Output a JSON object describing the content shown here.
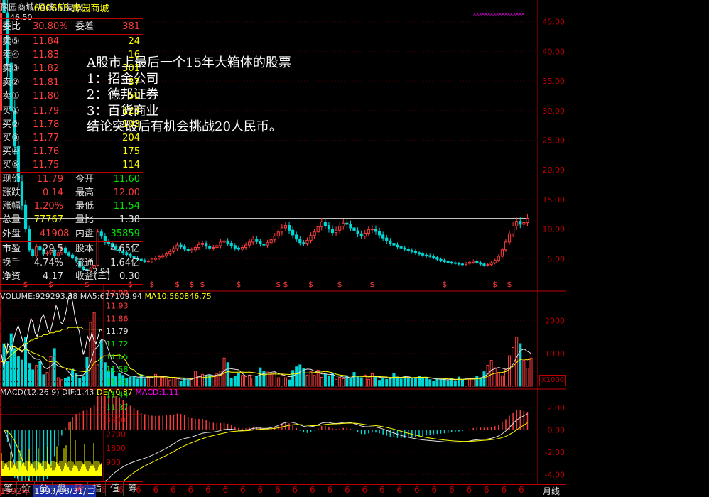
{
  "header": {
    "title": "豫园商城(月线,前复权)",
    "volume_legend": {
      "vol": "VOLUME:929293.38",
      "ma5": "MA5:617109.94",
      "ma10": "MA10:560846.75"
    },
    "macd_legend": {
      "params": "MACD(12,26,9)",
      "dif": "DIF:1.43",
      "dea": "DEA:0.87",
      "macd": "MACD:1.11"
    },
    "unit_label": "X1000"
  },
  "annotation": {
    "lines": [
      "A股市上最后一个15年大箱体的股票",
      "1：招金公司",
      "2：德邦证券",
      "3：百货商业",
      "结论突破后有机会挑战20人民币。"
    ]
  },
  "chart_data": [
    {
      "type": "candlestick",
      "title": "豫园商城(月线,前复权)",
      "y_axis_ticks": [
        "45.00",
        "40.00",
        "35.00",
        "30.00",
        "25.00",
        "20.00",
        "15.00",
        "10.00",
        "5.00"
      ],
      "ylim": [
        0,
        47
      ],
      "price_labels": {
        "high": "46.50",
        "low": "2.94"
      },
      "resistance_line": 11.8,
      "dollar_markers": 17,
      "closes": [
        46.5,
        38,
        30,
        24,
        18,
        14,
        10,
        6.5,
        5.5,
        7,
        6.5,
        5.8,
        6,
        6.4,
        5.5,
        6,
        6.8,
        6,
        5.6,
        5.2,
        4.6,
        3.6,
        3.2,
        3.0,
        3.4,
        3.9,
        9.5,
        8.8,
        7.8,
        7.6,
        7.0,
        6.6,
        6.3,
        6.0,
        5.7,
        5.4,
        5.1,
        4.9,
        4.7,
        4.5,
        4.6,
        4.9,
        5.1,
        5.3,
        5.5,
        5.8,
        6.2,
        6.7,
        7.3,
        7.0,
        6.6,
        6.3,
        6.5,
        6.9,
        7.4,
        7.6,
        7.1,
        6.8,
        6.9,
        7.2,
        7.8,
        8.0,
        7.6,
        7.2,
        6.8,
        6.6,
        6.9,
        7.3,
        7.8,
        8.3,
        7.9,
        7.5,
        7.3,
        7.7,
        8.2,
        8.8,
        9.5,
        10.2,
        10.6,
        9.8,
        9.0,
        8.3,
        7.7,
        7.6,
        8.1,
        8.9,
        9.5,
        10.4,
        11.2,
        10.6,
        10.0,
        9.4,
        9.8,
        10.5,
        11.0,
        10.8,
        10.2,
        9.7,
        9.2,
        8.8,
        9.3,
        9.9,
        10.0,
        9.6,
        9.0,
        8.5,
        8.0,
        7.6,
        7.3,
        7.0,
        6.8,
        6.6,
        6.4,
        6.2,
        6.0,
        5.8,
        5.6,
        5.5,
        5.4,
        5.2,
        4.9,
        4.7,
        4.5,
        4.4,
        4.3,
        4.2,
        4.1,
        4.0,
        4.2,
        4.4,
        4.6,
        4.3,
        4.1,
        3.9,
        4.0,
        4.3,
        4.7,
        5.4,
        6.5,
        7.8,
        9.2,
        10.5,
        11.3,
        10.8,
        11.1,
        11.79
      ],
      "x_labels": [
        "1992年",
        "1993/08/31/二"
      ]
    },
    {
      "type": "bar",
      "title": "VOLUME",
      "y_axis_ticks": [
        "2000",
        "1000"
      ],
      "ylim": [
        0,
        2600
      ],
      "unit": "X1000",
      "values": [
        1300,
        750,
        1600,
        1150,
        900,
        800,
        1500,
        700,
        500,
        640,
        760,
        350,
        420,
        900,
        1150,
        260,
        200,
        240,
        280,
        520,
        400,
        230,
        290,
        880,
        1950,
        2250,
        650,
        1400,
        720,
        470,
        540,
        290,
        390,
        330,
        240,
        280,
        310,
        220,
        350,
        220,
        260,
        280,
        360,
        300,
        270,
        240,
        190,
        270,
        230,
        160,
        230,
        190,
        240,
        460,
        300,
        360,
        320,
        330,
        300,
        390,
        460,
        860,
        720,
        230,
        300,
        380,
        330,
        290,
        340,
        250,
        310,
        560,
        460,
        430,
        360,
        410,
        260,
        330,
        260,
        190,
        480,
        590,
        650,
        550,
        340,
        440,
        330,
        490,
        270,
        370,
        300,
        390,
        210,
        270,
        230,
        320,
        250,
        420,
        300,
        260,
        340,
        210,
        380,
        270,
        180,
        260,
        210,
        250,
        380,
        280,
        220,
        310,
        260,
        240,
        260,
        310,
        230,
        270,
        200,
        160,
        240,
        190,
        220,
        170,
        240,
        160,
        280,
        200,
        250,
        230,
        220,
        310,
        260,
        440,
        640,
        790,
        560,
        420,
        320,
        500,
        930,
        1180,
        1500,
        1300,
        790,
        550,
        860
      ]
    },
    {
      "type": "bar",
      "title": "MACD",
      "y_axis_ticks": [
        "2.00",
        "0.00",
        "-2.00",
        "-4.00"
      ],
      "ylim": [
        -4.6,
        3.0
      ],
      "dif": 1.43,
      "dea": 0.87,
      "macd": 1.11
    },
    {
      "type": "line",
      "title": "分时",
      "y_axis_ticks": [
        "12.00",
        "11.93",
        "11.86",
        "11.79",
        "11.72",
        "11.65",
        "11.58",
        "11.51",
        "11.44",
        "11.37"
      ],
      "ylim": [
        11.34,
        12.03
      ],
      "volume_ticks": [
        "3600",
        "2700",
        "1800",
        "900"
      ],
      "prices": [
        11.66,
        11.6,
        11.63,
        11.72,
        11.7,
        11.68,
        11.75,
        11.79,
        11.82,
        11.78,
        11.74,
        11.7,
        11.74,
        11.8,
        11.86,
        11.84,
        11.78,
        11.76,
        11.81,
        11.86,
        11.88,
        11.85,
        11.8,
        11.78,
        11.82,
        11.87,
        11.93,
        11.9,
        11.84,
        11.83,
        11.86,
        11.91,
        11.98,
        12.0,
        11.94,
        11.87,
        11.82,
        11.79,
        11.72,
        11.66,
        11.7,
        11.76,
        11.73,
        11.78,
        11.74,
        11.72,
        11.76,
        11.8,
        11.79
      ],
      "averages": [
        11.62,
        11.62,
        11.63,
        11.64,
        11.65,
        11.66,
        11.67,
        11.68,
        11.69,
        11.7,
        11.71,
        11.72,
        11.72,
        11.73,
        11.74,
        11.74,
        11.75,
        11.75,
        11.76,
        11.76,
        11.77,
        11.77,
        11.77,
        11.78,
        11.78,
        11.78,
        11.79,
        11.79,
        11.79,
        11.8,
        11.8,
        11.8,
        11.81,
        11.81,
        11.81,
        11.81,
        11.81,
        11.81,
        11.81,
        11.8,
        11.8,
        11.8,
        11.8,
        11.8,
        11.8,
        11.8,
        11.8,
        11.8,
        11.8
      ]
    }
  ],
  "quote": {
    "code": "600655",
    "name": "豫园商城",
    "weibi_label": "委比",
    "weibi_value": "30.80%",
    "weicha_label": "委差",
    "weicha_value": "381",
    "sell": [
      {
        "label": "卖⑤",
        "price": "11.84",
        "vol": "24"
      },
      {
        "label": "卖④",
        "price": "11.83",
        "vol": "16"
      },
      {
        "label": "卖③",
        "price": "11.82",
        "vol": "301"
      },
      {
        "label": "卖②",
        "price": "11.81",
        "vol": "37"
      },
      {
        "label": "卖①",
        "price": "11.80",
        "vol": "50"
      }
    ],
    "buy": [
      {
        "label": "买①",
        "price": "11.79",
        "vol": "123"
      },
      {
        "label": "买②",
        "price": "11.78",
        "vol": "193"
      },
      {
        "label": "买③",
        "price": "11.77",
        "vol": "204"
      },
      {
        "label": "买④",
        "price": "11.76",
        "vol": "175"
      },
      {
        "label": "买⑤",
        "price": "11.75",
        "vol": "114"
      }
    ],
    "stats": [
      {
        "l1": "现价",
        "v1": "11.79",
        "l2": "今开",
        "v2": "11.60"
      },
      {
        "l1": "涨跌",
        "v1": "0.14",
        "l2": "最高",
        "v2": "12.00"
      },
      {
        "l1": "涨幅",
        "v1": "1.20%",
        "l2": "最低",
        "v2": "11.54"
      },
      {
        "l1": "总量",
        "v1": "77767",
        "l2": "量比",
        "v2": "1.38"
      }
    ],
    "outer_label": "外盘",
    "outer_value": "41908",
    "inner_label": "内盘",
    "inner_value": "35859",
    "fund": [
      {
        "l1": "市盈",
        "v1": "29.5",
        "l2": "股本",
        "v2": "4.65亿"
      },
      {
        "l1": "换手",
        "v1": "4.74%",
        "l2": "流通",
        "v2": "1.64亿"
      },
      {
        "l1": "净资",
        "v1": "4.17",
        "l2": "收益(三)",
        "v2": "0.30"
      }
    ]
  },
  "tabs": [
    "笔",
    "价",
    "分",
    "盘",
    "势",
    "指",
    "值",
    "筹"
  ],
  "bottom": {
    "period": "月线",
    "year_label": "1992年",
    "date_label": "1993/08/31/二",
    "tick_char": "6"
  }
}
